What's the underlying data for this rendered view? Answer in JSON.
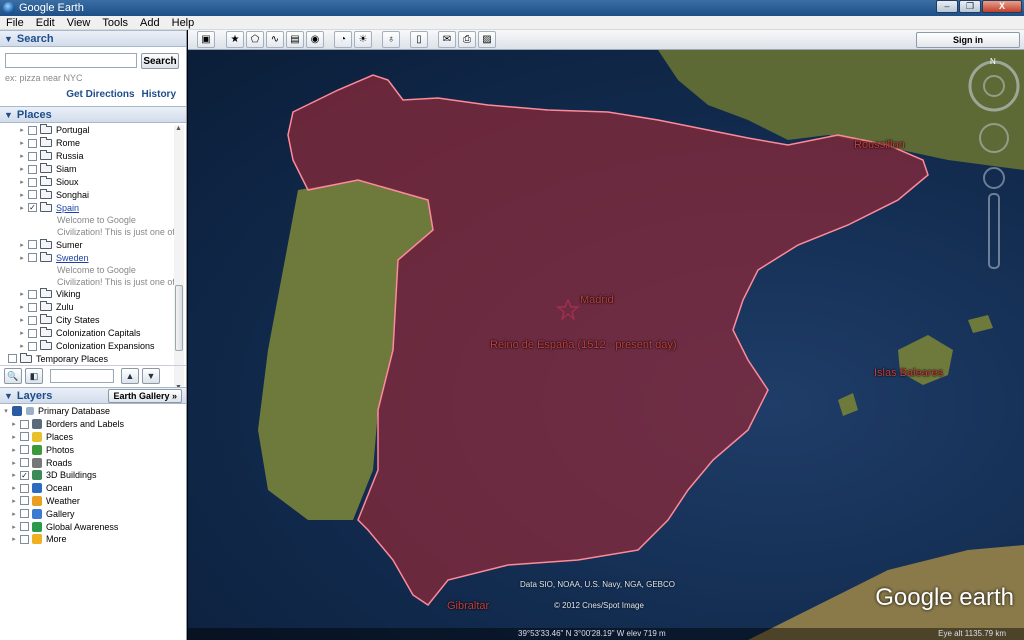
{
  "window": {
    "title": "Google Earth",
    "controls": [
      "–",
      "❐",
      "X"
    ]
  },
  "menu": [
    "File",
    "Edit",
    "View",
    "Tools",
    "Add",
    "Help"
  ],
  "search": {
    "header": "Search",
    "button_label": "Search",
    "hint": "ex: pizza near NYC",
    "get_directions": "Get Directions",
    "history": "History",
    "input_value": ""
  },
  "places": {
    "header": "Places",
    "items": [
      {
        "label": "Portugal",
        "checked": false,
        "link": false
      },
      {
        "label": "Rome",
        "checked": false,
        "link": false
      },
      {
        "label": "Russia",
        "checked": false,
        "link": false
      },
      {
        "label": "Siam",
        "checked": false,
        "link": false
      },
      {
        "label": "Sioux",
        "checked": false,
        "link": false
      },
      {
        "label": "Songhai",
        "checked": false,
        "link": false
      },
      {
        "label": "Spain",
        "checked": true,
        "link": true,
        "desc": [
          "Welcome to Google",
          "Civilization! This is just one of"
        ]
      },
      {
        "label": "Sumer",
        "checked": false,
        "link": false
      },
      {
        "label": "Sweden",
        "checked": false,
        "link": true,
        "desc": [
          "Welcome to Google",
          "Civilization! This is just one of"
        ]
      },
      {
        "label": "Viking",
        "checked": false,
        "link": false
      },
      {
        "label": "Zulu",
        "checked": false,
        "link": false
      },
      {
        "label": "City States",
        "checked": false,
        "link": false
      },
      {
        "label": "Colonization Capitals",
        "checked": false,
        "link": false
      },
      {
        "label": "Colonization Expansions",
        "checked": false,
        "link": false
      }
    ],
    "temporary": "Temporary Places"
  },
  "layers": {
    "header": "Layers",
    "gallery_button": "Earth Gallery »",
    "primary": "Primary Database",
    "items": [
      {
        "label": "Borders and Labels",
        "checked": false,
        "color": "#5a6a7a"
      },
      {
        "label": "Places",
        "checked": false,
        "color": "#e8c02a"
      },
      {
        "label": "Photos",
        "checked": false,
        "color": "#3a9a3a"
      },
      {
        "label": "Roads",
        "checked": false,
        "color": "#777777"
      },
      {
        "label": "3D Buildings",
        "checked": true,
        "color": "#3a8a5a"
      },
      {
        "label": "Ocean",
        "checked": false,
        "color": "#2a6ac0"
      },
      {
        "label": "Weather",
        "checked": false,
        "color": "#e8a020"
      },
      {
        "label": "Gallery",
        "checked": false,
        "color": "#3a7ad0"
      },
      {
        "label": "Global Awareness",
        "checked": false,
        "color": "#2a9a4a"
      },
      {
        "label": "More",
        "checked": false,
        "color": "#f0b020"
      }
    ]
  },
  "toolbar": {
    "sign_in": "Sign in"
  },
  "map": {
    "labels": {
      "madrid": "Madrid",
      "kingdom": "Reino de España (1512 - present day)",
      "roussillon": "Roussillon",
      "baleares": "Islas Baleares",
      "gibraltar": "Gibraltar"
    },
    "attribution": "Data SIO, NOAA, U.S. Navy, NGA, GEBCO",
    "copyright": "© 2012 Cnes/Spot Image",
    "logo": "Google earth",
    "status": {
      "coords": "39°53'33.46\" N   3°00'28.19\" W  elev   719 m",
      "eye_alt": "Eye alt  1135.79 km"
    },
    "colors": {
      "region_fill": "#8a2a3a",
      "region_border": "#ff8a9a",
      "label": "#c04040"
    }
  }
}
